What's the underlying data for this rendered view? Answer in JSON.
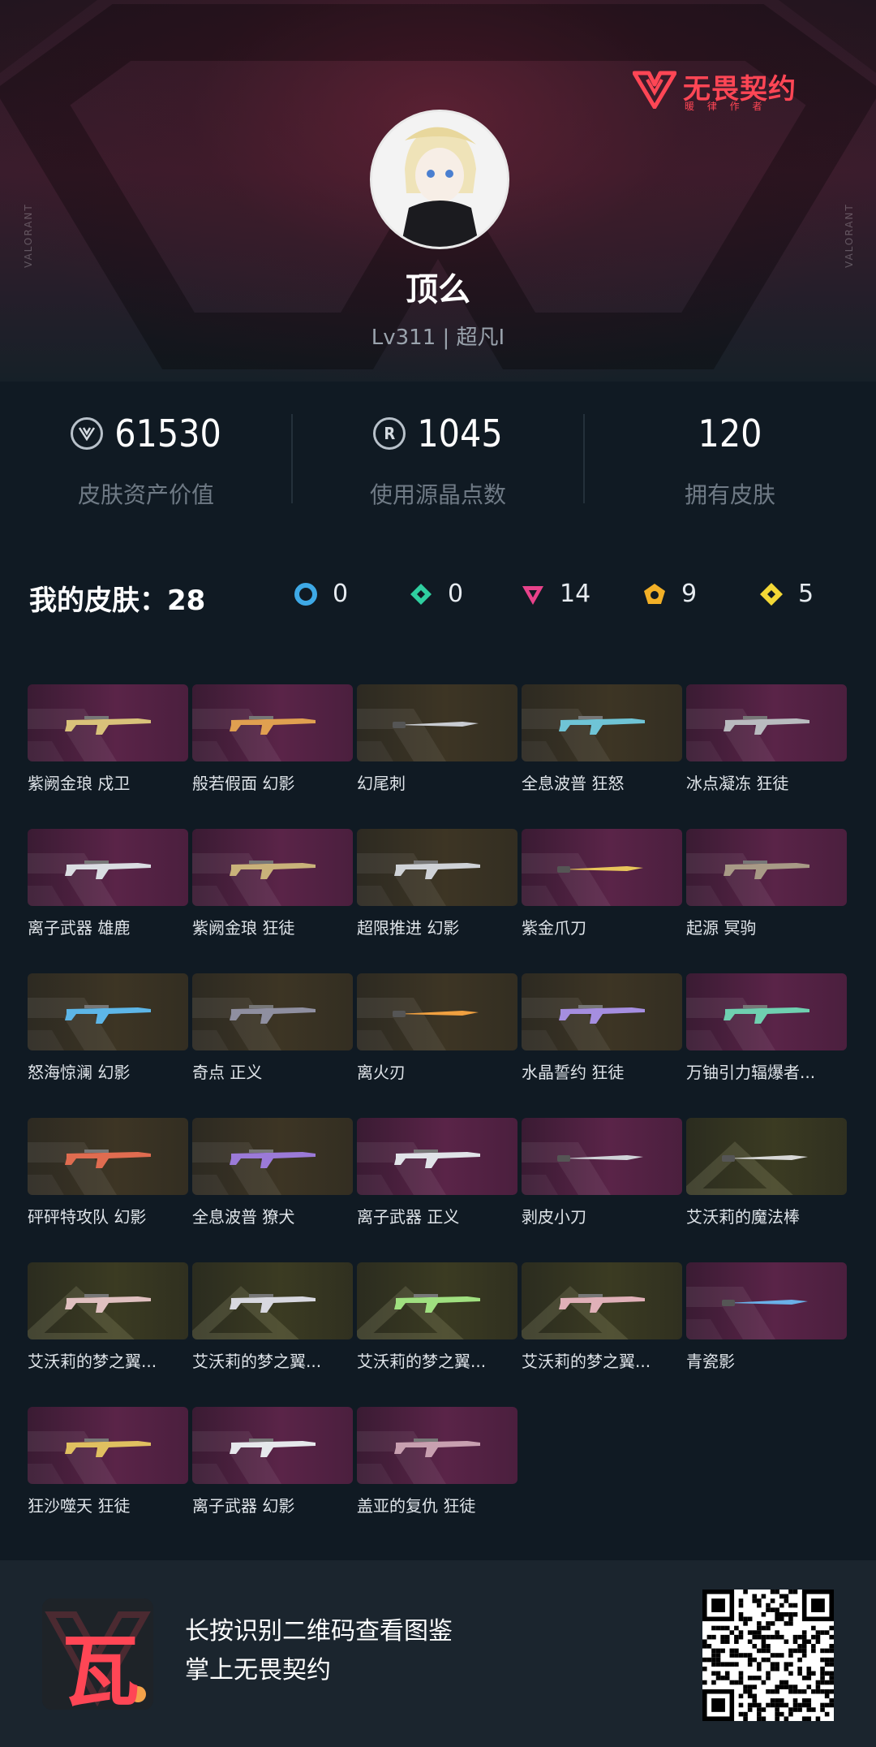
{
  "header": {
    "logo_text": "无畏契约",
    "logo_sub": "暖 律 作 者",
    "side_text": "VALORANT"
  },
  "profile": {
    "username": "顶么",
    "level": "Lv311 | 超凡I"
  },
  "stats": [
    {
      "icon": "valorant-points-icon",
      "value": "61530",
      "label": "皮肤资产价值"
    },
    {
      "icon": "radianite-icon",
      "value": "1045",
      "label": "使用源晶点数"
    },
    {
      "icon": "",
      "value": "120",
      "label": "拥有皮肤"
    }
  ],
  "skins_summary": {
    "title": "我的皮肤：28",
    "tiers": [
      {
        "icon": "select-tier-icon",
        "color": "#3ea9e6",
        "count": "0"
      },
      {
        "icon": "deluxe-tier-icon",
        "color": "#2fcfa0",
        "count": "0"
      },
      {
        "icon": "premium-tier-icon",
        "color": "#e8428a",
        "count": "14"
      },
      {
        "icon": "ultra-tier-icon",
        "color": "#f2b027",
        "count": "9"
      },
      {
        "icon": "exclusive-tier-icon",
        "color": "#f3d836",
        "count": "5"
      }
    ]
  },
  "skins": [
    {
      "name": "紫阙金琅 戍卫",
      "bg": "purple"
    },
    {
      "name": "般若假面 幻影",
      "bg": "purple"
    },
    {
      "name": "幻尾刺",
      "bg": "gold"
    },
    {
      "name": "全息波普 狂怒",
      "bg": "gold"
    },
    {
      "name": "冰点凝冻 狂徒",
      "bg": "purple"
    },
    {
      "name": "离子武器 雄鹿",
      "bg": "purple"
    },
    {
      "name": "紫阙金琅 狂徒",
      "bg": "purple"
    },
    {
      "name": "超限推进 幻影",
      "bg": "gold"
    },
    {
      "name": "紫金爪刀",
      "bg": "purple"
    },
    {
      "name": "起源 冥驹",
      "bg": "purple"
    },
    {
      "name": "怒海惊澜 幻影",
      "bg": "gold"
    },
    {
      "name": "奇点 正义",
      "bg": "gold"
    },
    {
      "name": "离火刃",
      "bg": "gold"
    },
    {
      "name": "水晶誓约 狂徒",
      "bg": "gold"
    },
    {
      "name": "万铀引力辐爆者...",
      "bg": "purple"
    },
    {
      "name": "砰砰特攻队 幻影",
      "bg": "gold"
    },
    {
      "name": "全息波普 獠犬",
      "bg": "gold"
    },
    {
      "name": "离子武器 正义",
      "bg": "purple"
    },
    {
      "name": "剥皮小刀",
      "bg": "purple"
    },
    {
      "name": "艾沃莉的魔法棒",
      "bg": "olive"
    },
    {
      "name": "艾沃莉的梦之翼...",
      "bg": "olive"
    },
    {
      "name": "艾沃莉的梦之翼...",
      "bg": "olive"
    },
    {
      "name": "艾沃莉的梦之翼...",
      "bg": "olive"
    },
    {
      "name": "艾沃莉的梦之翼...",
      "bg": "olive"
    },
    {
      "name": "青瓷影",
      "bg": "purple"
    },
    {
      "name": "狂沙噬天 狂徒",
      "bg": "purple"
    },
    {
      "name": "离子武器 幻影",
      "bg": "purple"
    },
    {
      "name": "盖亚的复仇 狂徒",
      "bg": "purple"
    }
  ],
  "footer": {
    "app_glyph": "瓦",
    "line1": "长按识别二维码查看图鉴",
    "line2": "掌上无畏契约"
  }
}
